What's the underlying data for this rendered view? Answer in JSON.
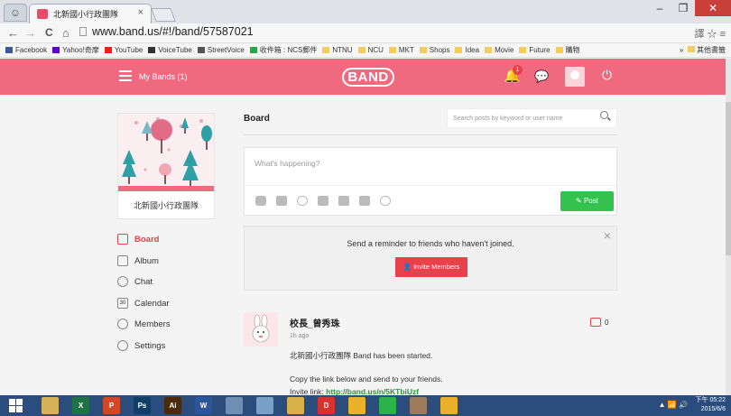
{
  "browser": {
    "tab_title": "北新國小行政團隊",
    "tab_close": "×",
    "url": "www.band.us/#!/band/57587021",
    "nav_back": "←",
    "nav_forward": "→",
    "nav_reload": "C",
    "nav_home": "⌂",
    "bookmarks": [
      {
        "label": "Facebook",
        "icon": "facebook-icon",
        "color": "#3b5998"
      },
      {
        "label": "Yahoo!奇摩",
        "icon": "yahoo-icon",
        "color": "#6001d2"
      },
      {
        "label": "YouTube",
        "icon": "youtube-icon",
        "color": "#e62117"
      },
      {
        "label": "VoiceTube",
        "icon": "voicetube-icon",
        "color": "#333333"
      },
      {
        "label": "StreetVoice",
        "icon": "streetvoice-icon",
        "color": "#555555"
      },
      {
        "label": "收件箱 : NCS郵件",
        "icon": "gmail-icon",
        "color": "#2aa845"
      },
      {
        "label": "NTNU",
        "icon": "folder-icon",
        "color": "#f5cb5c"
      },
      {
        "label": "NCU",
        "icon": "folder-icon",
        "color": "#f5cb5c"
      },
      {
        "label": "MKT",
        "icon": "folder-icon",
        "color": "#f5cb5c"
      },
      {
        "label": "Shops",
        "icon": "folder-icon",
        "color": "#f5cb5c"
      },
      {
        "label": "Idea",
        "icon": "folder-icon",
        "color": "#f5cb5c"
      },
      {
        "label": "Movie",
        "icon": "folder-icon",
        "color": "#f5cb5c"
      },
      {
        "label": "Future",
        "icon": "folder-icon",
        "color": "#f5cb5c"
      },
      {
        "label": "購物",
        "icon": "folder-icon",
        "color": "#f5cb5c"
      }
    ],
    "bookmarks_overflow": "»",
    "other_bookmarks": "其他書籤"
  },
  "header": {
    "my_bands": "My Bands (1)",
    "logo": "BAND",
    "notification_count": "1",
    "accent": "#f06a7f"
  },
  "band": {
    "name": "北新國小行政團隊"
  },
  "sidebar": {
    "items": [
      {
        "label": "Board",
        "icon": "board-icon",
        "active": true
      },
      {
        "label": "Album",
        "icon": "album-icon",
        "active": false
      },
      {
        "label": "Chat",
        "icon": "chat-icon",
        "active": false
      },
      {
        "label": "Calendar",
        "icon": "calendar-icon",
        "active": false
      },
      {
        "label": "Members",
        "icon": "members-icon",
        "active": false
      },
      {
        "label": "Settings",
        "icon": "settings-icon",
        "active": false
      }
    ],
    "calendar_day": "30"
  },
  "board": {
    "title": "Board",
    "search_placeholder": "Search posts by keyword or user name",
    "composer_placeholder": "What's happening?",
    "post_button": "Post",
    "tools": [
      "sticker-icon",
      "camera-icon",
      "attachment-icon",
      "video-icon",
      "poll-icon",
      "todo-icon",
      "fraction-icon"
    ]
  },
  "reminder": {
    "text": "Send a reminder to friends who haven't joined.",
    "button": "Invite Members",
    "close": "×"
  },
  "post": {
    "author": "校長_曾秀珠",
    "time": "1h ago",
    "line1": "北新國小行政團隊 Band has been started.",
    "line2": "Copy the link below and send to your friends.",
    "invite_label": "Invite link: ",
    "invite_link": "http://band.us/n/5KTbiUzf",
    "comment_count": "0"
  },
  "taskbar": {
    "apps": [
      {
        "name": "explorer",
        "label": "",
        "color": "#d8b25a"
      },
      {
        "name": "excel",
        "label": "X",
        "color": "#1f7244"
      },
      {
        "name": "powerpoint",
        "label": "P",
        "color": "#d24726"
      },
      {
        "name": "photoshop",
        "label": "Ps",
        "color": "#0f3e66"
      },
      {
        "name": "illustrator",
        "label": "Ai",
        "color": "#4a2a07"
      },
      {
        "name": "word",
        "label": "W",
        "color": "#2b579a"
      },
      {
        "name": "tool-a",
        "label": "",
        "color": "#6f8fb2"
      },
      {
        "name": "tool-b",
        "label": "",
        "color": "#7aa0c8"
      },
      {
        "name": "folder",
        "label": "",
        "color": "#d9b14a"
      },
      {
        "name": "app-d",
        "label": "D",
        "color": "#d8322e"
      },
      {
        "name": "chrome",
        "label": "",
        "color": "#e9b22a"
      },
      {
        "name": "line",
        "label": "",
        "color": "#2cb34a"
      },
      {
        "name": "app-g",
        "label": "",
        "color": "#9c7b5c"
      },
      {
        "name": "chrome-2",
        "label": "",
        "color": "#e9b22a"
      }
    ],
    "time": "下午 05:22",
    "date": "2015/6/6"
  }
}
